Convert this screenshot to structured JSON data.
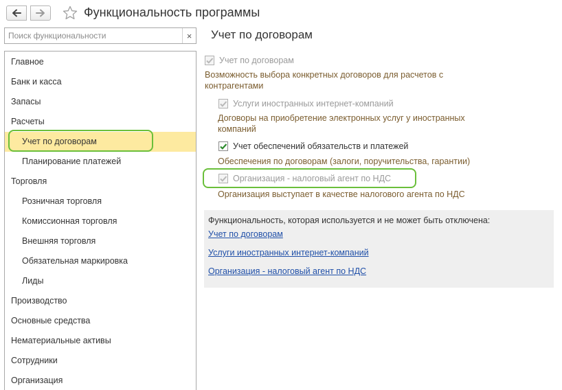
{
  "header": {
    "title": "Функциональность программы",
    "back_icon": "arrow-left-icon",
    "forward_icon": "arrow-right-icon",
    "favorite_icon": "star-icon"
  },
  "search": {
    "placeholder": "Поиск функциональности",
    "value": "",
    "clear_label": "×"
  },
  "sidebar": {
    "items": [
      {
        "label": "Главное",
        "level": 1
      },
      {
        "label": "Банк и касса",
        "level": 1
      },
      {
        "label": "Запасы",
        "level": 1
      },
      {
        "label": "Расчеты",
        "level": 1
      },
      {
        "label": "Учет по договорам",
        "level": 2,
        "selected": true
      },
      {
        "label": "Планирование платежей",
        "level": 2
      },
      {
        "label": "Торговля",
        "level": 1
      },
      {
        "label": "Розничная торговля",
        "level": 2
      },
      {
        "label": "Комиссионная торговля",
        "level": 2
      },
      {
        "label": "Внешняя торговля",
        "level": 2
      },
      {
        "label": "Обязательная маркировка",
        "level": 2
      },
      {
        "label": "Лиды",
        "level": 2
      },
      {
        "label": "Производство",
        "level": 1
      },
      {
        "label": "Основные средства",
        "level": 1
      },
      {
        "label": "Нематериальные активы",
        "level": 1
      },
      {
        "label": "Сотрудники",
        "level": 1
      },
      {
        "label": "Организация",
        "level": 1
      }
    ]
  },
  "main": {
    "title": "Учет по договорам",
    "options": [
      {
        "label": "Учет по договорам",
        "checked": true,
        "enabled": false,
        "description": "Возможность выбора конкретных договоров для расчетов с контрагентами"
      },
      {
        "label": "Услуги иностранных интернет-компаний",
        "checked": true,
        "enabled": false,
        "description": "Договоры на приобретение электронных услуг у иностранных компаний"
      },
      {
        "label": "Учет обеспечений обязательств и платежей",
        "checked": true,
        "enabled": true,
        "description": "Обеспечения по договорам (залоги, поручительства, гарантии)"
      },
      {
        "label": "Организация - налоговый агент по НДС",
        "checked": true,
        "enabled": false,
        "description": "Организация выступает в качестве налогового агента по НДС"
      }
    ],
    "info": {
      "title": "Функциональность, которая используется и не может быть отключена:",
      "links": [
        "Учет по договорам",
        "Услуги иностранных интернет-компаний",
        "Организация - налоговый агент по НДС"
      ]
    }
  },
  "colors": {
    "selection": "#fdeaa0",
    "highlight": "#6abf3a",
    "description": "#7a5c2e",
    "link": "#1f4fa8",
    "check_active": "#2e8b2e",
    "check_disabled": "#b8b8b8"
  }
}
